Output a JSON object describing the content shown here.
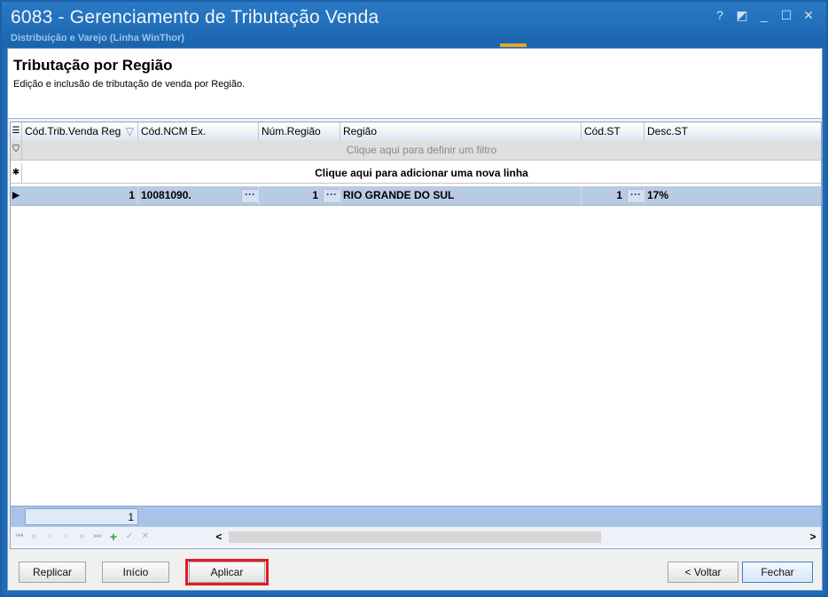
{
  "window": {
    "title": "6083 - Gerenciamento de Tributação Venda",
    "subtitle": "Distribuição e Varejo (Linha WinThor)",
    "controls": {
      "help": "?",
      "restore": "◩",
      "minimize": "_",
      "maximize": "☐",
      "close": "✕"
    }
  },
  "header": {
    "title": "Tributação por Região",
    "description": "Edição e inclusão de tributação de venda por Região."
  },
  "grid": {
    "columns": [
      "Cód.Trib.Venda Reg",
      "Cód.NCM Ex.",
      "Núm.Região",
      "Região",
      "Cód.ST",
      "Desc.ST"
    ],
    "filter_placeholder": "Clique aqui para definir um filtro",
    "new_row_text": "Clique aqui para adicionar uma nova linha",
    "rows": [
      {
        "cod_trib": "1",
        "cod_ncm": "10081090.",
        "num_regiao": "1",
        "regiao": "RIO GRANDE DO SUL",
        "cod_st": "1",
        "desc_st": "17%"
      }
    ],
    "footer_count": "1",
    "ellipsis_label": "···"
  },
  "navigator": {
    "icons": [
      "first-icon",
      "prev-page-icon",
      "prev-icon",
      "next-icon",
      "next-page-icon",
      "last-icon",
      "add-icon",
      "confirm-icon",
      "cancel-icon"
    ],
    "glyphs": {
      "first": "⏮",
      "prev_page": "«",
      "prev": "‹",
      "next": "›",
      "next_page": "»",
      "last": "⏭",
      "add": "+",
      "confirm": "✓",
      "cancel": "✕"
    },
    "scroll_left": "<",
    "scroll_right": ">"
  },
  "buttons": {
    "replicar": "Replicar",
    "inicio": "Início",
    "aplicar": "Aplicar",
    "voltar": "< Voltar",
    "fechar": "Fechar"
  },
  "colors": {
    "titlebar": "#1e6ab4",
    "accent": "#e8a623",
    "selected_row": "#b9cbe3",
    "highlight": "#e21c24"
  }
}
